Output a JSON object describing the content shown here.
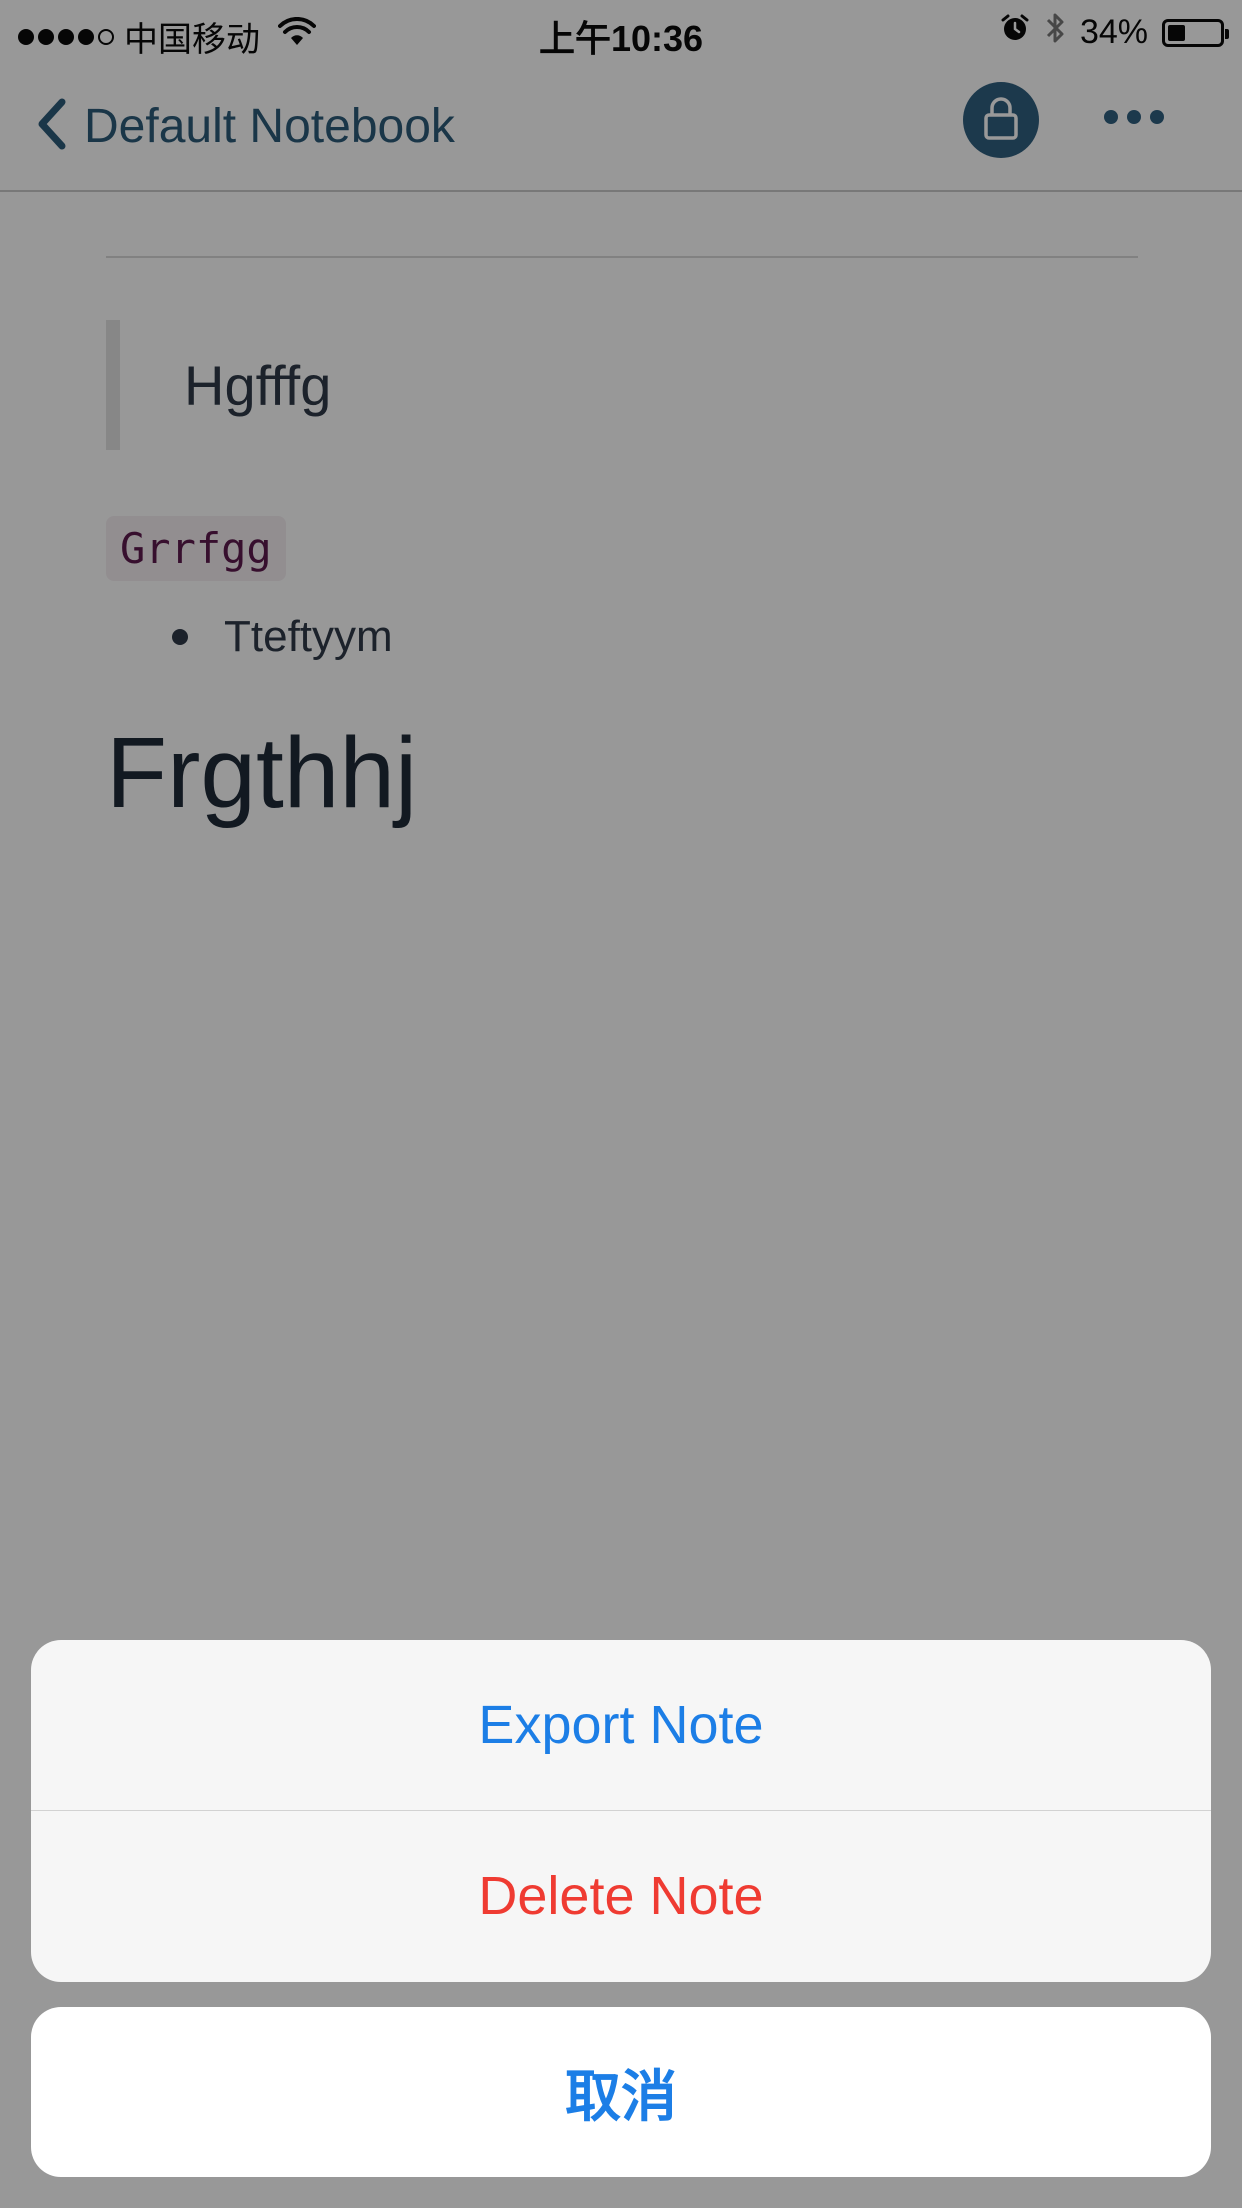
{
  "status_bar": {
    "carrier": "中国移动",
    "time": "上午10:36",
    "battery_percent": "34%",
    "battery_level": 0.34,
    "signal_bars": 4,
    "signal_total": 5
  },
  "nav": {
    "back_label": "Default Notebook",
    "accent_color": "#2f5f7f"
  },
  "note": {
    "blockquote": "Hgfffg",
    "code": "Grrfgg",
    "list_items": [
      "Tteftyym"
    ],
    "heading": "Frgthhj"
  },
  "action_sheet": {
    "export_label": "Export Note",
    "delete_label": "Delete Note",
    "cancel_label": "取消",
    "action_color": "#1c7ee6",
    "destructive_color": "#ef3b32"
  }
}
